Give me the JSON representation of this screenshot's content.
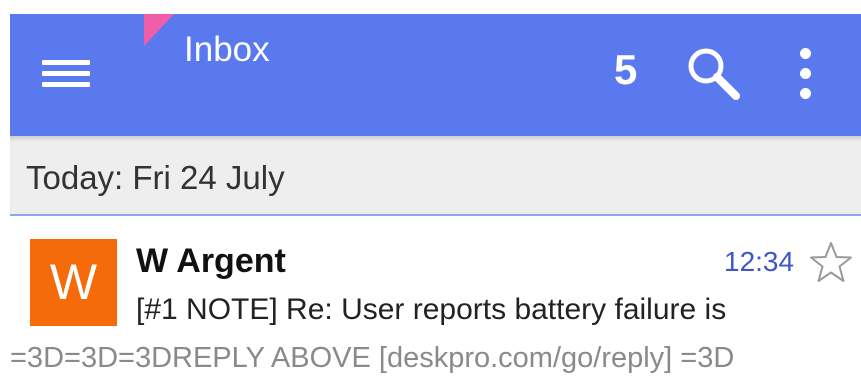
{
  "appbar": {
    "title": "Inbox",
    "unread_count": "5",
    "icons": {
      "menu": "menu-icon",
      "search": "search-icon",
      "overflow": "more-vertical-icon"
    }
  },
  "date_header": {
    "label": "Today: Fri 24 July"
  },
  "messages": [
    {
      "avatar_letter": "W",
      "sender": "W Argent",
      "time": "12:34",
      "subject": "[#1 NOTE] Re: User reports battery failure is",
      "preview": "=3D=3D=3DREPLY ABOVE [deskpro.com/go/reply] =3D",
      "starred": false
    }
  ],
  "colors": {
    "appbar": "#5b79ee",
    "avatar": "#f56b0a",
    "time": "#3f55c8",
    "flag": "#ee5fa8"
  }
}
